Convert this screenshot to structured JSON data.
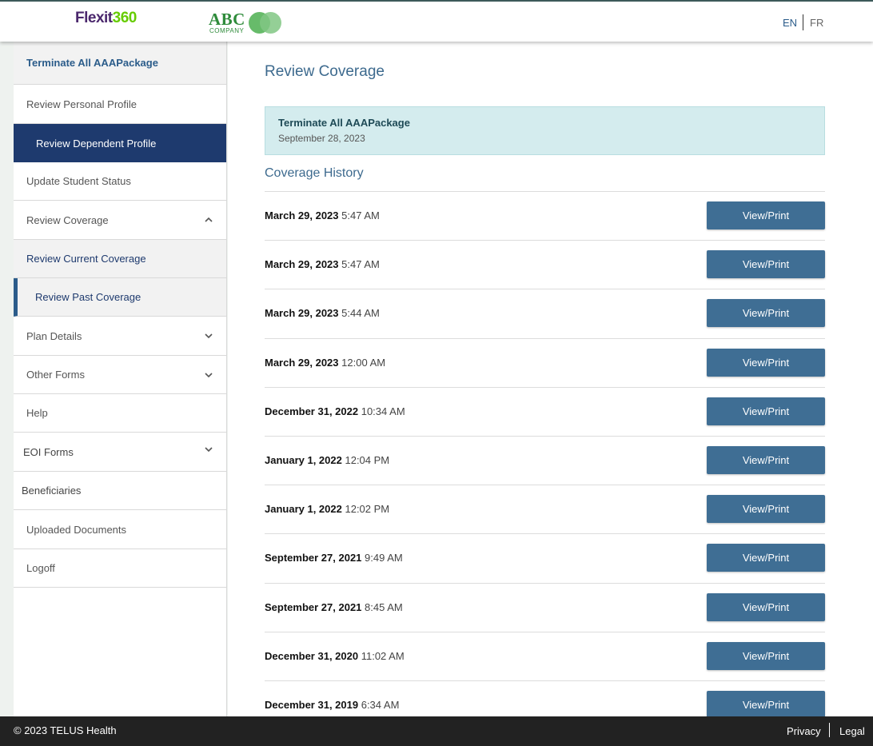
{
  "header": {
    "logo_flexit_part1": "Flexit",
    "logo_flexit_part2": "360",
    "logo_abc": "ABC",
    "logo_abc_sub": "COMPANY",
    "lang_en": "EN",
    "lang_fr": "FR"
  },
  "sidebar": {
    "items": [
      {
        "label": "Terminate All AAAPackage",
        "style": "top"
      },
      {
        "label": "Review Personal Profile"
      },
      {
        "label": "Review Dependent Profile",
        "style": "active"
      },
      {
        "label": "Update Student Status"
      },
      {
        "label": "Review Coverage",
        "chevron": "up"
      },
      {
        "label": "Review Current Coverage",
        "style": "sub"
      },
      {
        "label": "Review Past Coverage",
        "style": "sub-active"
      },
      {
        "label": "Plan Details",
        "chevron": "down"
      },
      {
        "label": "Other Forms",
        "chevron": "down"
      },
      {
        "label": "Help"
      },
      {
        "label": "EOI Forms",
        "chevron": "down"
      },
      {
        "label": "Beneficiaries"
      },
      {
        "label": "Uploaded Documents"
      },
      {
        "label": "Logoff"
      }
    ]
  },
  "main": {
    "title": "Review Coverage",
    "banner": {
      "title": "Terminate All AAAPackage",
      "date": "September 28, 2023"
    },
    "history_title": "Coverage History",
    "history": [
      {
        "date": "March 29, 2023",
        "time": "5:47 AM",
        "button": "View/Print"
      },
      {
        "date": "March 29, 2023",
        "time": "5:47 AM",
        "button": "View/Print"
      },
      {
        "date": "March 29, 2023",
        "time": "5:44 AM",
        "button": "View/Print"
      },
      {
        "date": "March 29, 2023",
        "time": "12:00 AM",
        "button": "View/Print"
      },
      {
        "date": "December 31, 2022",
        "time": "10:34 AM",
        "button": "View/Print"
      },
      {
        "date": "January 1, 2022",
        "time": "12:04 PM",
        "button": "View/Print"
      },
      {
        "date": "January 1, 2022",
        "time": "12:02 PM",
        "button": "View/Print"
      },
      {
        "date": "September 27, 2021",
        "time": "9:49 AM",
        "button": "View/Print"
      },
      {
        "date": "September 27, 2021",
        "time": "8:45 AM",
        "button": "View/Print"
      },
      {
        "date": "December 31, 2020",
        "time": "11:02 AM",
        "button": "View/Print"
      },
      {
        "date": "December 31, 2019",
        "time": "6:34 AM",
        "button": "View/Print"
      }
    ]
  },
  "footer": {
    "copyright": "© 2023 TELUS Health",
    "privacy": "Privacy",
    "legal": "Legal"
  }
}
